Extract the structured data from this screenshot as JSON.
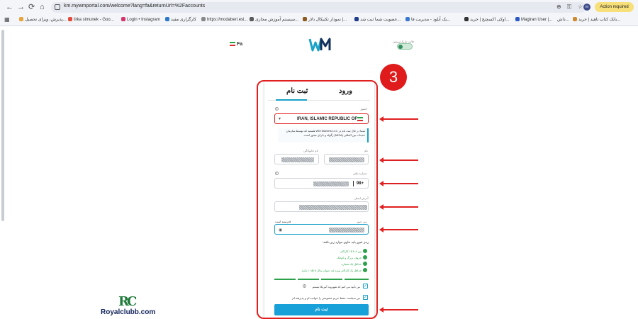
{
  "browser": {
    "url": "km.mywmportal.com/welcome?lang=fa&returnUrl=%2Faccounts",
    "action_label": "Action required",
    "avatar_letter": "m",
    "bookmarks": [
      "بانک کتاب تاهید | خرید...",
      "داش...",
      "Magiran User |...",
      "اوکی اکسچنج | خرید...",
      "یک آیلود - مدیریت فا...",
      "عضویت شما ثبت شد...",
      "نمودار تکنیکال دلار |...",
      "سیستم آموزش مجازی...",
      "https://modaberi.esi...",
      "کارگزاری مفید",
      "Login • Instagram",
      "lirka simunek - Goo...",
      "پذیرش، ویزای تحصیل..."
    ]
  },
  "header": {
    "lang_label": "Fa",
    "toggle_label": "حالت تاریک/روشن"
  },
  "form": {
    "step_number": "3",
    "tabs": {
      "login": "ورود",
      "register": "ثبت نام"
    },
    "country": {
      "label": "کشور",
      "value": "IRAN, ISLAMIC REPUBLIC OF"
    },
    "notice": "شما در حال ثبت نام در WM Markets LLC هستید که توسط سازمان خدمات بین المللی (MISA) رگوله و دارای مجوز است.",
    "first_name_label": "نام",
    "last_name_label": "نام خانوادگی",
    "phone": {
      "label": "شماره تلفن",
      "prefix": "98+"
    },
    "email_label": "آدرس ایمیل",
    "password_label": "رمز عبور",
    "password_strength_text": "قدرتمند است",
    "password_rules_title": "رمز عبور باید حاوی موارد زیر باشد:",
    "password_rules": [
      "بین ۸ تا ۱۵ کاراکتر",
      "حروف بزرگ و کوچک",
      "حداقل یک شماره",
      "حداقل یک کاراکتر ویژه (به عنوان مثال # @ ! ) باشد"
    ],
    "checkbox_us": "من تأیید می کنم که شهروند آمریکا نیستم",
    "checkbox_terms": "من سیاست حفظ حریم خصوصی را خوانده ام و پذیرفته ام",
    "submit_label": "ثبت نام"
  },
  "watermark": {
    "logo_letters": "RC",
    "site": "Royalclubb.com"
  },
  "colors": {
    "accent": "#18a0d8",
    "annotation_red": "#e0201f",
    "success_green": "#2aa14a"
  }
}
